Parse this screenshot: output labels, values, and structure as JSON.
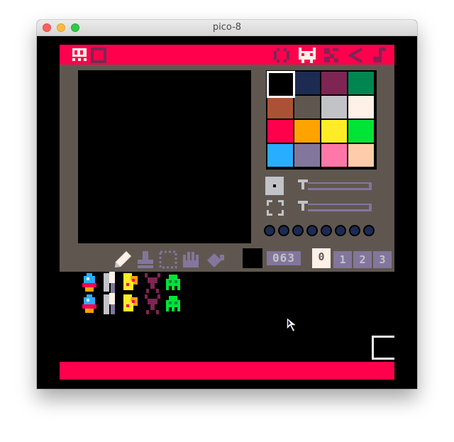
{
  "window": {
    "title": "pico-8",
    "controls": [
      "close",
      "minimize",
      "maximize"
    ]
  },
  "toolbar": {
    "left_icons": [
      "sprite-editor-icon",
      "fullscreen-icon"
    ],
    "right_icons": [
      "code-editor-icon",
      "sprite-editor-tab-icon",
      "map-editor-icon",
      "sfx-editor-icon",
      "music-editor-icon"
    ]
  },
  "palette": {
    "colors": [
      "#000000",
      "#1d2b53",
      "#7e2553",
      "#008751",
      "#ab5236",
      "#5f574f",
      "#c2c3c7",
      "#fff1e8",
      "#ff004d",
      "#ffa300",
      "#ffec27",
      "#00e436",
      "#29adff",
      "#83769c",
      "#ff77a8",
      "#ffccaa"
    ],
    "selected_index": 0
  },
  "sliders": [
    {
      "name": "brush-size",
      "value": 0
    },
    {
      "name": "zoom",
      "value": 0
    }
  ],
  "flags": {
    "count": 8,
    "set": [
      false,
      false,
      false,
      false,
      false,
      false,
      false,
      false
    ]
  },
  "tools": [
    "pencil-icon",
    "stamp-icon",
    "select-icon",
    "pan-hand-icon",
    "fill-icon"
  ],
  "sprite_number": "063",
  "tabs": [
    "0",
    "1",
    "2",
    "3"
  ],
  "active_tab": 0
}
